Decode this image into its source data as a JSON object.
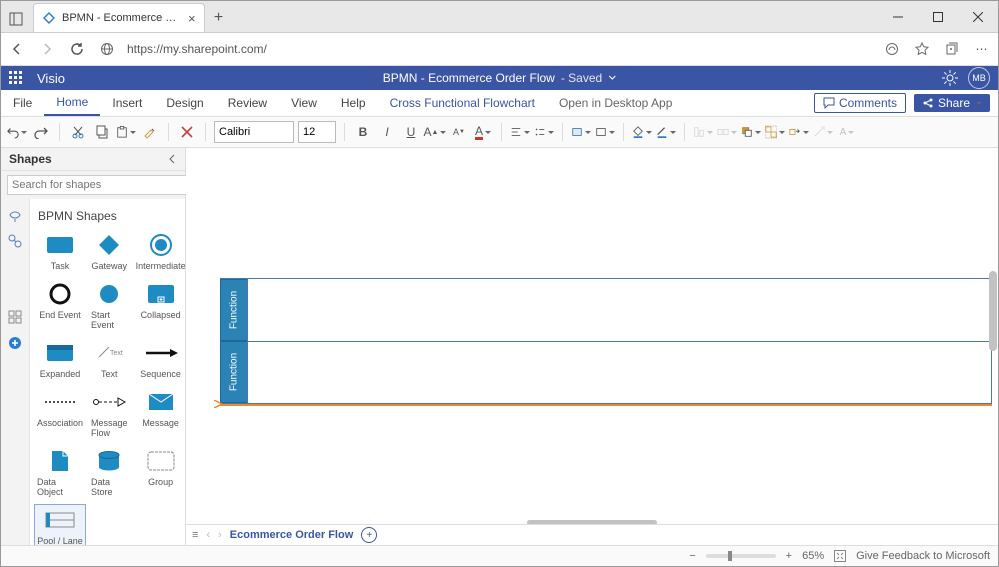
{
  "browser": {
    "tab_title": "BPMN - Ecommerce Order Flow…",
    "url": "https://my.sharepoint.com/"
  },
  "header": {
    "app_name": "Visio",
    "doc_title": "BPMN - Ecommerce Order Flow",
    "save_state": "Saved",
    "avatar_initials": "MB"
  },
  "ribbon": {
    "tabs": {
      "file": "File",
      "home": "Home",
      "insert": "Insert",
      "design": "Design",
      "review": "Review",
      "view": "View",
      "help": "Help",
      "contextual": "Cross Functional Flowchart"
    },
    "open_desktop": "Open in Desktop App",
    "comments": "Comments",
    "share": "Share"
  },
  "toolbar": {
    "font_name": "Calibri",
    "font_size": "12"
  },
  "shapes": {
    "panel_title": "Shapes",
    "search_placeholder": "Search for shapes",
    "section_title": "BPMN Shapes",
    "items": {
      "task": "Task",
      "gateway": "Gateway",
      "intermediate": "Intermediate",
      "end_event": "End Event",
      "start_event": "Start Event",
      "collapsed": "Collapsed",
      "expanded": "Expanded",
      "text": "Text",
      "sequence": "Sequence",
      "association": "Association",
      "message_flow": "Message Flow",
      "message": "Message",
      "data_object": "Data Object",
      "data_store": "Data Store",
      "group": "Group",
      "pool_lane": "Pool / Lane"
    }
  },
  "canvas": {
    "lane1": "Function",
    "lane2": "Function"
  },
  "sheet": {
    "name": "Ecommerce Order Flow"
  },
  "status": {
    "zoom": "65%",
    "feedback": "Give Feedback to Microsoft"
  }
}
